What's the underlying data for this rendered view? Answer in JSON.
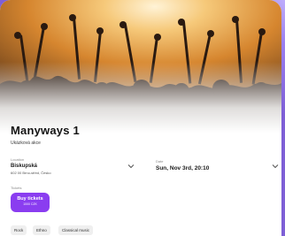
{
  "event": {
    "title": "Manyways 1",
    "subtitle": "Ukázková akce"
  },
  "location": {
    "label": "Location",
    "name": "Biskupská",
    "address": "602 00 Brno-střed, Česko"
  },
  "date": {
    "label": "Date",
    "value": "Sun, Nov 3rd, 20:10"
  },
  "tickets": {
    "label": "Tickets",
    "button_label": "Buy tickets",
    "price": "1000 CZK"
  },
  "tags": [
    "Rock",
    "Ethno",
    "Classical music"
  ],
  "colors": {
    "accent": "#8a3df0",
    "background": "#7e5fd6",
    "hero_warm": "#e8a24a"
  },
  "icons": {
    "location_dropdown": "chevron-down-icon",
    "date_dropdown": "chevron-down-icon"
  }
}
